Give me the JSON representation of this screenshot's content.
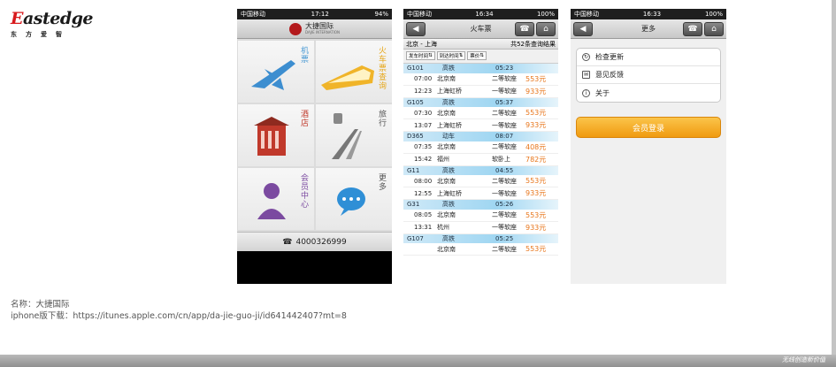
{
  "logo": {
    "brand_red": "E",
    "brand_rest": "astedge",
    "subtitle": "东方爱智"
  },
  "phone1": {
    "status": {
      "carrier": "中国移动",
      "time": "17:12",
      "battery": "94%"
    },
    "header": {
      "brand": "大捷国际",
      "brand_sub": "DAJIE INTERNATION"
    },
    "tiles": [
      {
        "label": "机票",
        "color": "#4a9ad4"
      },
      {
        "label": "火车票查询",
        "color": "#e6a618"
      },
      {
        "label": "酒店",
        "color": "#c0392b"
      },
      {
        "label": "旅行",
        "color": "#555555"
      },
      {
        "label": "会员中心",
        "color": "#7b4aa0"
      },
      {
        "label": "更多",
        "color": "#555555"
      }
    ],
    "phone": "4000326999"
  },
  "phone2": {
    "status": {
      "carrier": "中国移动",
      "time": "16:34",
      "battery": "100%"
    },
    "title": "火车票",
    "route": "北京 - 上海",
    "result_count": "共52条查询结果",
    "sort": [
      "发车时间",
      "到达时间",
      "票价"
    ],
    "trains": [
      {
        "no": "G101",
        "type": "高铁",
        "duration": "05:23",
        "stops": [
          {
            "time": "07:00",
            "station": "北京南",
            "seat": "二等软座",
            "price": "553元"
          },
          {
            "time": "12:23",
            "station": "上海虹桥",
            "seat": "一等软座",
            "price": "933元"
          }
        ]
      },
      {
        "no": "G105",
        "type": "高铁",
        "duration": "05:37",
        "stops": [
          {
            "time": "07:30",
            "station": "北京南",
            "seat": "二等软座",
            "price": "553元"
          },
          {
            "time": "13:07",
            "station": "上海虹桥",
            "seat": "一等软座",
            "price": "933元"
          }
        ]
      },
      {
        "no": "D365",
        "type": "动车",
        "duration": "08:07",
        "stops": [
          {
            "time": "07:35",
            "station": "北京南",
            "seat": "二等软座",
            "price": "408元"
          },
          {
            "time": "15:42",
            "station": "福州",
            "seat": "软卧上",
            "price": "782元"
          }
        ]
      },
      {
        "no": "G11",
        "type": "高铁",
        "duration": "04:55",
        "stops": [
          {
            "time": "08:00",
            "station": "北京南",
            "seat": "二等软座",
            "price": "553元"
          },
          {
            "time": "12:55",
            "station": "上海虹桥",
            "seat": "一等软座",
            "price": "933元"
          }
        ]
      },
      {
        "no": "G31",
        "type": "高铁",
        "duration": "05:26",
        "stops": [
          {
            "time": "08:05",
            "station": "北京南",
            "seat": "二等软座",
            "price": "553元"
          },
          {
            "time": "13:31",
            "station": "杭州",
            "seat": "一等软座",
            "price": "933元"
          }
        ]
      },
      {
        "no": "G107",
        "type": "高铁",
        "duration": "05:25",
        "stops": [
          {
            "time": "",
            "station": "北京南",
            "seat": "二等软座",
            "price": "553元"
          }
        ]
      }
    ]
  },
  "phone3": {
    "status": {
      "carrier": "中国移动",
      "time": "16:33",
      "battery": "100%"
    },
    "title": "更多",
    "menu": [
      {
        "icon": "refresh-icon",
        "label": "检查更新"
      },
      {
        "icon": "mail-icon",
        "label": "意见反馈"
      },
      {
        "icon": "info-icon",
        "label": "关于"
      }
    ],
    "member_button": "会员登录"
  },
  "caption": {
    "name": "名称：大捷国际",
    "download": "iphone版下载：https://itunes.apple.com/cn/app/da-jie-guo-ji/id641442407?mt=8"
  },
  "footer": "无线创造新价值"
}
